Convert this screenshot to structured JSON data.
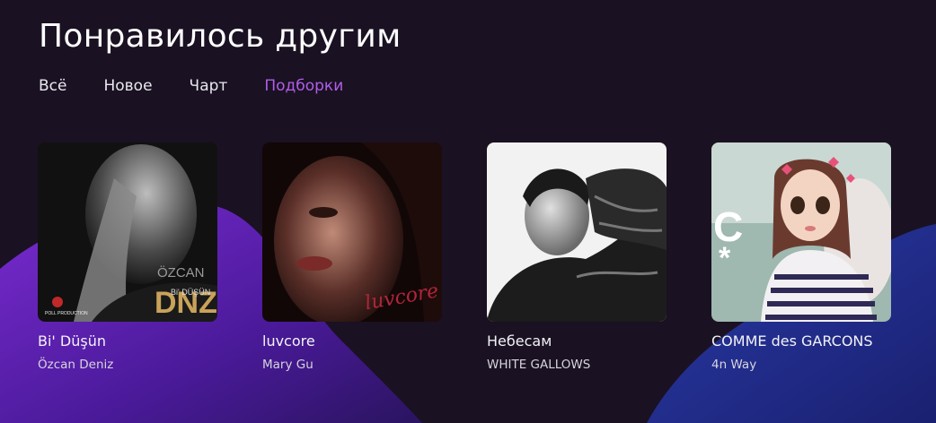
{
  "page_title": "Понравилось другим",
  "tabs": [
    {
      "label": "Всё",
      "active": false
    },
    {
      "label": "Новое",
      "active": false
    },
    {
      "label": "Чарт",
      "active": false
    },
    {
      "label": "Подборки",
      "active": true
    }
  ],
  "cards": [
    {
      "title": "Bi' Düşün",
      "artist": "Özcan Deniz",
      "cover_text": [
        "ÖZCAN",
        "DNZ",
        "Bi' DÜŞÜN",
        "POLL PRODUCTION"
      ]
    },
    {
      "title": "luvcore",
      "artist": "Mary Gu",
      "cover_text": [
        "luvcore"
      ]
    },
    {
      "title": "Небесам",
      "artist": "WHITE GALLOWS",
      "cover_text": []
    },
    {
      "title": "COMME des GARCONS",
      "artist": "4n Way",
      "cover_text": [
        "C",
        "*"
      ]
    }
  ],
  "colors": {
    "background": "#1a1122",
    "accent": "#b15ee8",
    "wave_left": "#6a22b8",
    "wave_right": "#2a3a9a"
  }
}
